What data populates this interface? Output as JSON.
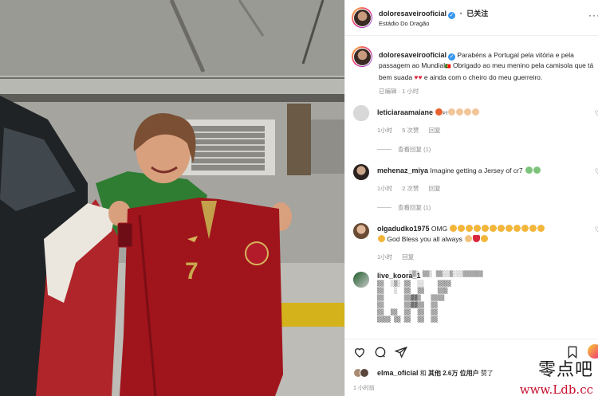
{
  "header": {
    "username": "doloresaveirooficial",
    "follow_status": "已关注",
    "location": "Estádio Do Dragão"
  },
  "caption": {
    "username": "doloresaveirooficial",
    "text_part1": "Parabéns a Portugal pela vitória e pela passagem ao Mundial",
    "text_part2": " Obrigado ao meu menino pela camisola que tá bem suada ",
    "text_part3": " e ainda com o cheiro do meu guerreiro.",
    "edited_label": "已编辑",
    "time": "1 小时"
  },
  "comments": [
    {
      "username": "leticiaraamaiane",
      "text": "",
      "time": "1小时",
      "likes": "5 次赞",
      "reply": "回复",
      "view_replies": "查看回复 (1)"
    },
    {
      "username": "mehenaz_miya",
      "text": "Imagine getting a Jersey of cr7",
      "time": "1小时",
      "likes": "2 次赞",
      "reply": "回复",
      "view_replies": "查看回复 (1)"
    },
    {
      "username": "olgadudko1975",
      "text": "OMG",
      "text2": "God Bless you all always",
      "time": "1小时",
      "reply": "回复"
    },
    {
      "username": "live_koora_1",
      "text": ""
    }
  ],
  "likes_line": {
    "user": "elma_oficial",
    "connector": "和",
    "others": "其他 2.6万 位用户",
    "suffix": "赞了"
  },
  "post_time": "1 小时前",
  "watermark": {
    "cn": "零点吧",
    "en": "www.Ldb.cc"
  },
  "photo": {
    "jersey_number": "7"
  },
  "colors": {
    "verified": "#3897f0",
    "link": "#00376b",
    "jersey": "#a0141c",
    "watermark_red": "#c8102e"
  }
}
